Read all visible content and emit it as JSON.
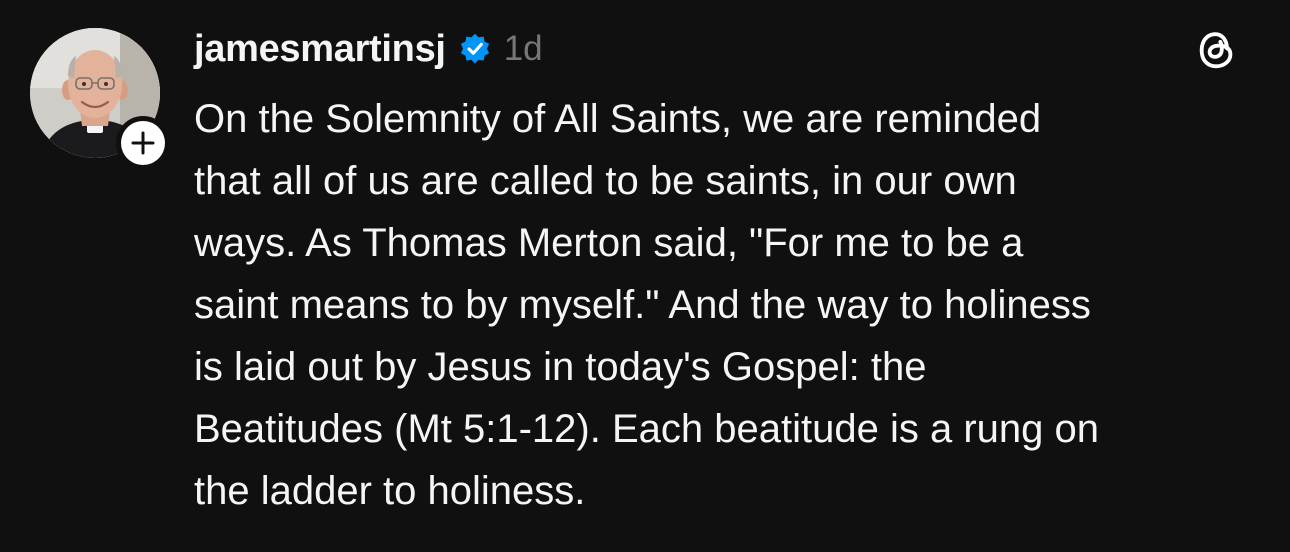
{
  "post": {
    "username": "jamesmartinsj",
    "timestamp": "1d",
    "verified": true,
    "text": "On the Solemnity of All Saints, we are reminded\nthat all of us are called to be saints, in our own\nways. As Thomas Merton said, \"For me to be a\nsaint means to by myself.\" And the way to holiness\nis laid out by Jesus in today's Gospel: the\nBeatitudes (Mt 5:1-12). Each beatitude is a rung on\nthe ladder to holiness."
  },
  "icons": {
    "verified": "verified-badge-icon",
    "follow": "plus-icon",
    "app": "threads-logo-icon"
  },
  "colors": {
    "background": "#101010",
    "text": "#f3f5f7",
    "muted": "#777777",
    "verified": "#0095f6"
  }
}
